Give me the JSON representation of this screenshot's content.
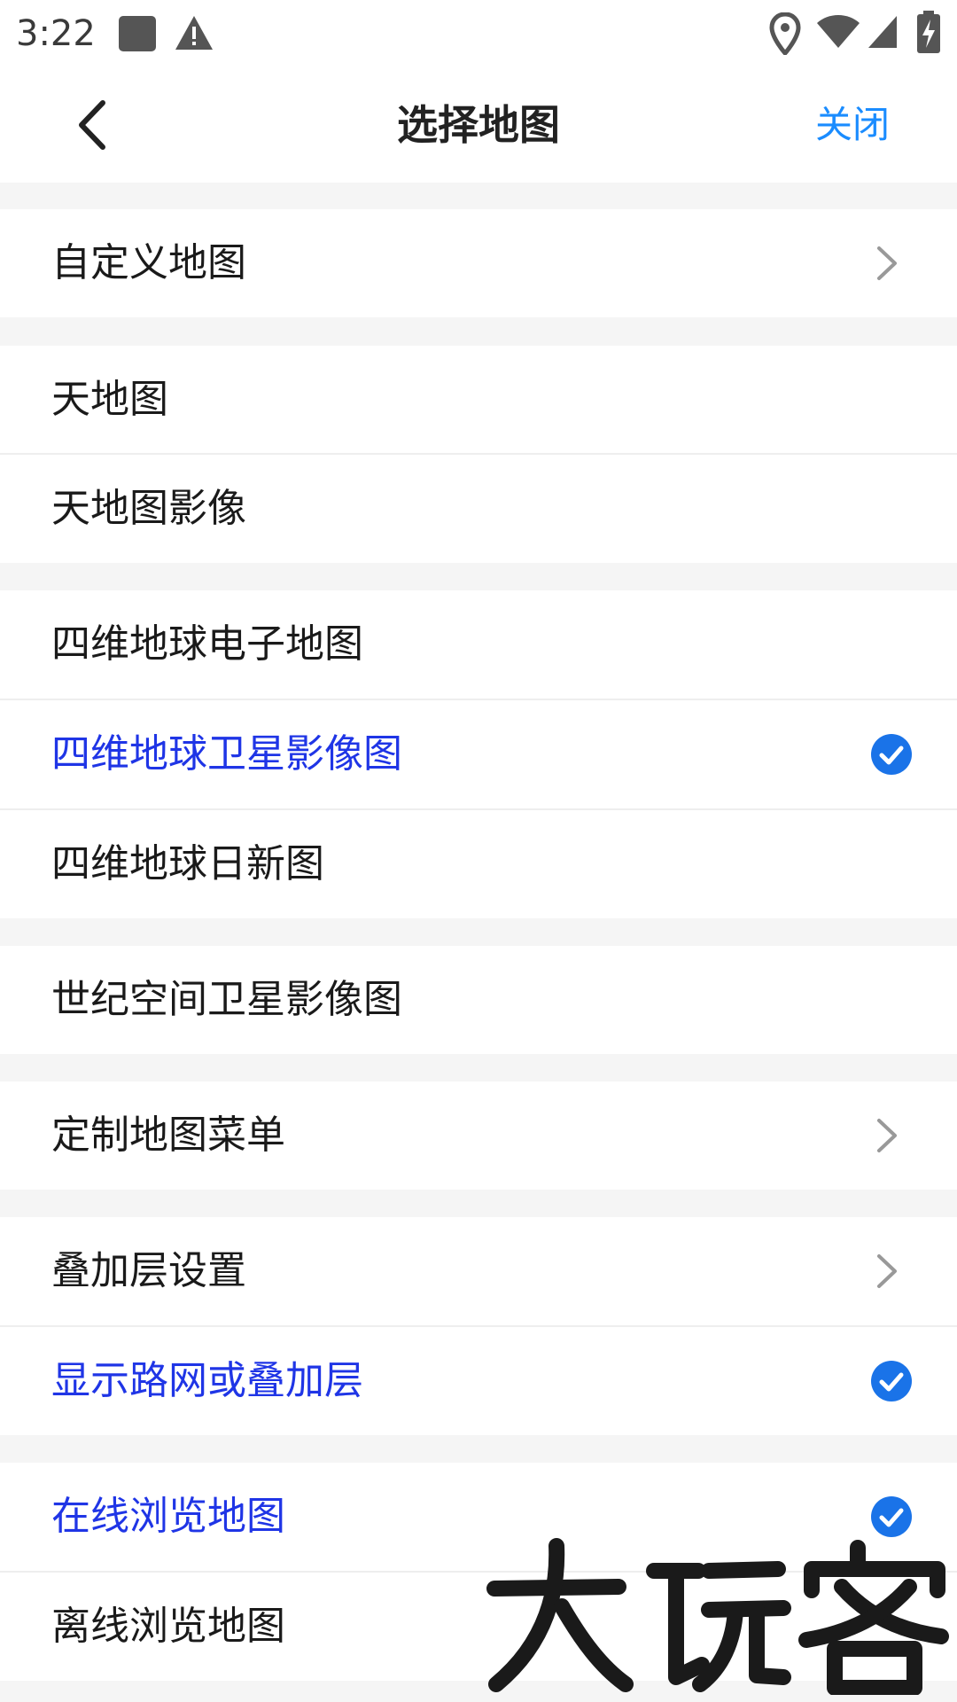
{
  "status_bar": {
    "time": "3:22",
    "icons": [
      "image-icon",
      "warning-icon",
      "location-icon",
      "wifi-icon",
      "signal-icon",
      "battery-charging-icon"
    ]
  },
  "header": {
    "title": "选择地图",
    "close_label": "关闭",
    "back_icon": "chevron-left-icon"
  },
  "colors": {
    "accent": "#1a8cff",
    "selected_text": "#1f35e6",
    "check_fill": "#1a73e8",
    "background": "#f5f5f5"
  },
  "groups": [
    {
      "items": [
        {
          "label": "自定义地图",
          "trailing": "chevron"
        }
      ]
    },
    {
      "items": [
        {
          "label": "天地图",
          "trailing": ""
        },
        {
          "label": "天地图影像",
          "trailing": ""
        }
      ]
    },
    {
      "items": [
        {
          "label": "四维地球电子地图",
          "trailing": ""
        },
        {
          "label": "四维地球卫星影像图",
          "trailing": "check",
          "selected": true
        },
        {
          "label": "四维地球日新图",
          "trailing": ""
        }
      ]
    },
    {
      "items": [
        {
          "label": "世纪空间卫星影像图",
          "trailing": ""
        }
      ]
    },
    {
      "items": [
        {
          "label": "定制地图菜单",
          "trailing": "chevron"
        }
      ]
    },
    {
      "items": [
        {
          "label": "叠加层设置",
          "trailing": "chevron"
        },
        {
          "label": "显示路网或叠加层",
          "trailing": "check",
          "selected": true
        }
      ]
    },
    {
      "items": [
        {
          "label": "在线浏览地图",
          "trailing": "check",
          "selected": true
        },
        {
          "label": "离线浏览地图",
          "trailing": ""
        }
      ]
    }
  ],
  "watermark": {
    "text": "大玩客"
  }
}
